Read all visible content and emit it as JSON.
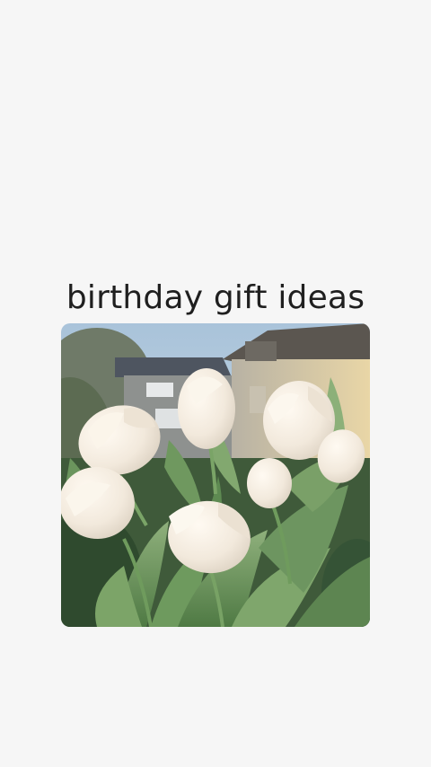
{
  "post": {
    "title": "birthday gift ideas",
    "image_subject": "white-tulips-photo"
  }
}
